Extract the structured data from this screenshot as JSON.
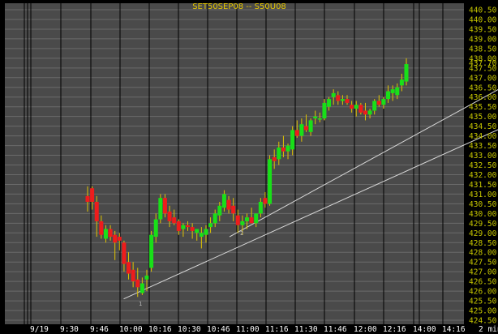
{
  "chart_data": {
    "type": "candlestick",
    "title": "SET50SEP08  --  S50U08",
    "interval_label": "2 min",
    "y_ticks": [
      "440.50",
      "440.00",
      "439.50",
      "439.00",
      "438.50",
      "438.00",
      "437.50",
      "437.00",
      "436.50",
      "436.00",
      "435.50",
      "435.00",
      "434.50",
      "434.00",
      "433.50",
      "433.00",
      "432.50",
      "432.00",
      "431.50",
      "431.00",
      "430.50",
      "430.00",
      "429.50",
      "429.00",
      "428.50",
      "428.00",
      "427.50",
      "427.00",
      "426.50",
      "426.00",
      "425.50",
      "425.00",
      "424.50"
    ],
    "ylim": [
      424.2,
      440.9
    ],
    "x_ticks": [
      "9/19",
      "9:30",
      "9:46",
      "10:00",
      "10:16",
      "10:30",
      "10:46",
      "11:00",
      "11:16",
      "11:30",
      "11:46",
      "12:00",
      "12:16",
      "14:00",
      "14:16"
    ],
    "grid": true,
    "price_marker": "437.70",
    "markers": [
      "1",
      "2"
    ],
    "series": [
      {
        "ohlc": [
          [
            430.9,
            431.4,
            430.1,
            430.6
          ],
          [
            431.3,
            431.4,
            430.2,
            430.6
          ],
          [
            430.6,
            430.9,
            428.8,
            429.6
          ],
          [
            429.6,
            429.9,
            428.7,
            428.9
          ],
          [
            428.7,
            429.4,
            428.5,
            429.2
          ],
          [
            429.2,
            429.4,
            428.6,
            428.8
          ],
          [
            428.9,
            429.1,
            427.6,
            428.5
          ],
          [
            428.8,
            429.0,
            428.1,
            428.6
          ],
          [
            428.5,
            428.6,
            427.0,
            427.4
          ],
          [
            427.5,
            428.0,
            426.6,
            426.9
          ],
          [
            427.1,
            427.5,
            426.2,
            426.5
          ],
          [
            426.6,
            427.2,
            425.7,
            426.2
          ],
          [
            425.9,
            426.7,
            425.8,
            426.4
          ],
          [
            426.6,
            427.1,
            426.0,
            426.8
          ],
          [
            427.2,
            429.1,
            427.0,
            428.9
          ],
          [
            428.8,
            430.0,
            428.5,
            429.7
          ],
          [
            429.7,
            431.0,
            429.5,
            430.8
          ],
          [
            430.8,
            431.0,
            429.8,
            430.0
          ],
          [
            430.1,
            430.4,
            429.3,
            429.6
          ],
          [
            429.8,
            430.2,
            429.4,
            429.5
          ],
          [
            429.6,
            429.7,
            428.9,
            429.1
          ],
          [
            429.2,
            429.5,
            428.8,
            429.4
          ],
          [
            429.4,
            429.6,
            429.1,
            429.3
          ],
          [
            429.3,
            429.5,
            428.7,
            429.1
          ],
          [
            429.0,
            429.2,
            428.6,
            429.2
          ],
          [
            428.8,
            429.3,
            428.2,
            429.0
          ],
          [
            428.9,
            429.4,
            428.5,
            429.2
          ],
          [
            429.3,
            429.8,
            429.0,
            429.5
          ],
          [
            429.5,
            430.2,
            429.3,
            430.0
          ],
          [
            429.9,
            430.6,
            429.6,
            430.4
          ],
          [
            430.3,
            431.2,
            430.1,
            431.0
          ],
          [
            430.7,
            430.9,
            430.0,
            430.2
          ],
          [
            430.4,
            430.8,
            429.6,
            430.0
          ],
          [
            429.9,
            430.2,
            429.0,
            429.4
          ],
          [
            429.4,
            429.9,
            428.9,
            429.6
          ],
          [
            429.6,
            430.0,
            429.2,
            429.8
          ],
          [
            429.8,
            430.3,
            429.5,
            429.5
          ],
          [
            429.5,
            430.0,
            429.3,
            430.0
          ],
          [
            430.0,
            430.8,
            429.8,
            430.6
          ],
          [
            430.8,
            431.1,
            430.3,
            430.5
          ],
          [
            430.5,
            433.0,
            430.4,
            432.8
          ],
          [
            432.9,
            433.3,
            432.3,
            432.7
          ],
          [
            432.8,
            433.7,
            432.5,
            433.4
          ],
          [
            433.4,
            434.0,
            432.9,
            433.2
          ],
          [
            433.2,
            433.6,
            432.8,
            433.5
          ],
          [
            433.3,
            434.5,
            433.0,
            434.3
          ],
          [
            434.3,
            434.8,
            433.9,
            434.0
          ],
          [
            434.0,
            434.9,
            433.7,
            434.6
          ],
          [
            434.5,
            435.1,
            434.2,
            434.3
          ],
          [
            434.2,
            434.9,
            434.0,
            434.8
          ],
          [
            434.9,
            435.3,
            434.6,
            435.0
          ],
          [
            434.9,
            435.2,
            434.7,
            434.9
          ],
          [
            434.9,
            435.9,
            434.8,
            435.7
          ],
          [
            435.5,
            436.0,
            435.3,
            435.9
          ],
          [
            436.0,
            436.4,
            435.6,
            436.2
          ],
          [
            436.1,
            436.3,
            435.6,
            435.8
          ],
          [
            435.8,
            436.1,
            435.6,
            435.9
          ],
          [
            435.9,
            436.1,
            435.6,
            435.7
          ],
          [
            435.6,
            435.8,
            435.2,
            435.4
          ],
          [
            435.4,
            435.8,
            435.0,
            435.6
          ],
          [
            435.6,
            435.7,
            435.1,
            435.2
          ],
          [
            435.3,
            435.7,
            434.8,
            435.1
          ],
          [
            435.1,
            435.4,
            434.9,
            435.3
          ],
          [
            435.3,
            435.9,
            435.1,
            435.8
          ],
          [
            435.8,
            436.1,
            435.5,
            435.6
          ],
          [
            435.6,
            436.0,
            435.4,
            435.9
          ],
          [
            435.9,
            436.6,
            435.7,
            436.3
          ],
          [
            436.2,
            436.6,
            435.8,
            436.4
          ],
          [
            436.1,
            436.7,
            435.9,
            436.5
          ],
          [
            436.6,
            437.2,
            436.3,
            436.9
          ],
          [
            436.8,
            438.0,
            436.6,
            437.7
          ]
        ]
      }
    ],
    "trendlines": [
      {
        "from": [
          "10:02",
          425.6
        ],
        "to": [
          "14:16",
          436.4
        ]
      },
      {
        "from": [
          "11:00",
          428.8
        ],
        "to": [
          "14:16",
          438.9
        ]
      }
    ]
  }
}
